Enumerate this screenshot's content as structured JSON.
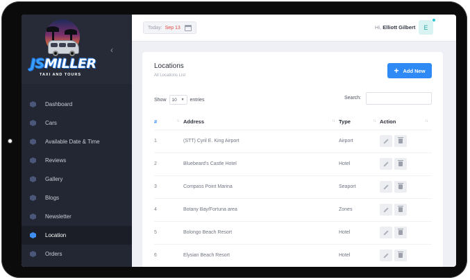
{
  "brand": {
    "name_part1": "JS",
    "name_part2": "MILLER",
    "tagline": "TAXI AND TOURS"
  },
  "sidebar": {
    "items": [
      {
        "label": "Dashboard",
        "active": false
      },
      {
        "label": "Cars",
        "active": false
      },
      {
        "label": "Available Date & Time",
        "active": false
      },
      {
        "label": "Reviews",
        "active": false
      },
      {
        "label": "Gallery",
        "active": false
      },
      {
        "label": "Blogs",
        "active": false
      },
      {
        "label": "Newsletter",
        "active": false
      },
      {
        "label": "Location",
        "active": true
      },
      {
        "label": "Orders",
        "active": false
      }
    ]
  },
  "header": {
    "today_label": "Today:",
    "today_date": "Sep 13",
    "greeting": "Hi,",
    "user_name": "Elliott Gilbert",
    "avatar_initial": "E"
  },
  "card": {
    "title": "Locations",
    "subtitle": "All Locations List",
    "add_button": "Add New",
    "show_label": "Show",
    "entries_value": "10",
    "entries_label": "entries",
    "search_label": "Search:",
    "search_value": ""
  },
  "table": {
    "columns": [
      "#",
      "Address",
      "Type",
      "Action"
    ],
    "rows": [
      {
        "num": "1",
        "address": "(STT) Cyril E. King Airport",
        "type": "Airport"
      },
      {
        "num": "2",
        "address": "Bluebeard's Castle Hotel",
        "type": "Hotel"
      },
      {
        "num": "3",
        "address": "Compass Point Marina",
        "type": "Seaport"
      },
      {
        "num": "4",
        "address": "Botany Bay/Fortuna area",
        "type": "Zones"
      },
      {
        "num": "5",
        "address": "Bolongo Beach Resort",
        "type": "Hotel"
      },
      {
        "num": "6",
        "address": "Elysian Beach Resort",
        "type": "Hotel"
      }
    ]
  },
  "colors": {
    "accent": "#2f8af5",
    "sidebar_bg": "#232733",
    "date": "#e2473e"
  },
  "icons": {
    "collapse": "chevron-left-icon",
    "calendar": "calendar-icon",
    "add": "plus-icon",
    "edit": "pencil-icon",
    "delete": "trash-icon"
  }
}
